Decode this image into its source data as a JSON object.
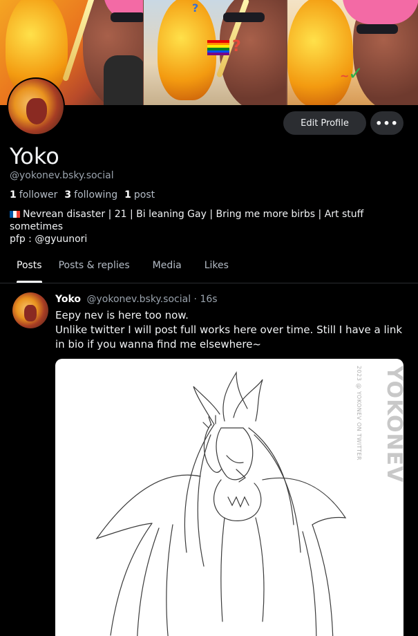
{
  "banner": {
    "symbols": {
      "question_1": "?",
      "question_2": "?",
      "tilde": "~",
      "check": "✓"
    },
    "pride_flag_colors": [
      "#e40303",
      "#ff8c00",
      "#ffed00",
      "#008026",
      "#004dff",
      "#750787"
    ]
  },
  "profile": {
    "display_name": "Yoko",
    "handle": "@yokonev.bsky.social",
    "followers_count": "1",
    "followers_label": "follower",
    "following_count": "3",
    "following_label": "following",
    "posts_count": "1",
    "posts_label": "post",
    "bio_line1": "Nevrean disaster | 21 | Bi leaning Gay | Bring me more birbs | Art stuff sometimes",
    "bio_line2": "pfp : @gyuunori",
    "bio_flag_icon": "french-flag-icon"
  },
  "actions": {
    "edit_profile_label": "Edit Profile",
    "more_label": "•••"
  },
  "tabs": [
    {
      "label": "Posts",
      "active": true
    },
    {
      "label": "Posts & replies",
      "active": false
    },
    {
      "label": "Media",
      "active": false
    },
    {
      "label": "Likes",
      "active": false
    }
  ],
  "post": {
    "author": "Yoko",
    "handle": "@yokonev.bsky.social",
    "separator": "·",
    "time": "16s",
    "text_line1": "Eepy nev is here too now.",
    "text_line2": "Unlike twitter I will post full works here over time. Still I have a link in bio if you wanna find me elsewhere~",
    "image": {
      "watermark_big": "YOKONEV",
      "watermark_small": "2023 @ YOKONEV ON TWITTER"
    }
  },
  "colors": {
    "background": "#000000",
    "button_bg": "#2b2d31",
    "muted_text": "#9aa3ad",
    "hat_pink": "#f36aa5",
    "hair_orange": "#f39a10"
  }
}
